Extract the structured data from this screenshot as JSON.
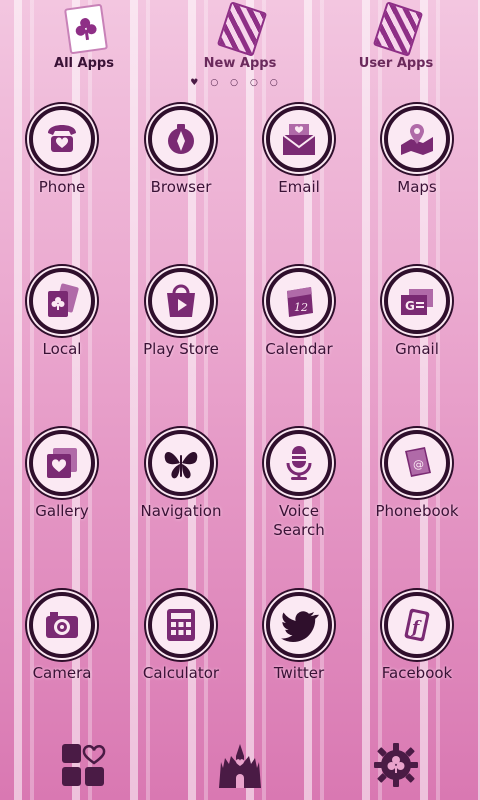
{
  "tabs": [
    {
      "label": "All Apps",
      "active": true
    },
    {
      "label": "New Apps",
      "active": false
    },
    {
      "label": "User Apps",
      "active": false
    }
  ],
  "page_indicator": {
    "count": 5,
    "current": 1
  },
  "apps": [
    {
      "label": "Phone",
      "icon": "telephone-icon"
    },
    {
      "label": "Browser",
      "icon": "compass-icon"
    },
    {
      "label": "Email",
      "icon": "envelope-icon"
    },
    {
      "label": "Maps",
      "icon": "map-pin-icon"
    },
    {
      "label": "Local",
      "icon": "playing-cards-icon"
    },
    {
      "label": "Play Store",
      "icon": "shopping-bag-icon"
    },
    {
      "label": "Calendar",
      "icon": "calendar-icon"
    },
    {
      "label": "Gmail",
      "icon": "gmail-icon"
    },
    {
      "label": "Gallery",
      "icon": "photo-heart-icon"
    },
    {
      "label": "Navigation",
      "icon": "butterfly-icon"
    },
    {
      "label": "Voice Search",
      "icon": "microphone-icon"
    },
    {
      "label": "Phonebook",
      "icon": "contact-book-icon"
    },
    {
      "label": "Camera",
      "icon": "camera-icon"
    },
    {
      "label": "Calculator",
      "icon": "calculator-icon"
    },
    {
      "label": "Twitter",
      "icon": "bird-icon"
    },
    {
      "label": "Facebook",
      "icon": "facebook-card-icon"
    }
  ],
  "dock": [
    {
      "icon": "app-grid-heart-icon"
    },
    {
      "icon": "castle-icon"
    },
    {
      "icon": "clover-gear-icon"
    }
  ],
  "colors": {
    "icon_fill": "#7a2a73",
    "icon_dark": "#2f0f2c",
    "ring": "#fbe9f3",
    "text": "#3a1236"
  }
}
